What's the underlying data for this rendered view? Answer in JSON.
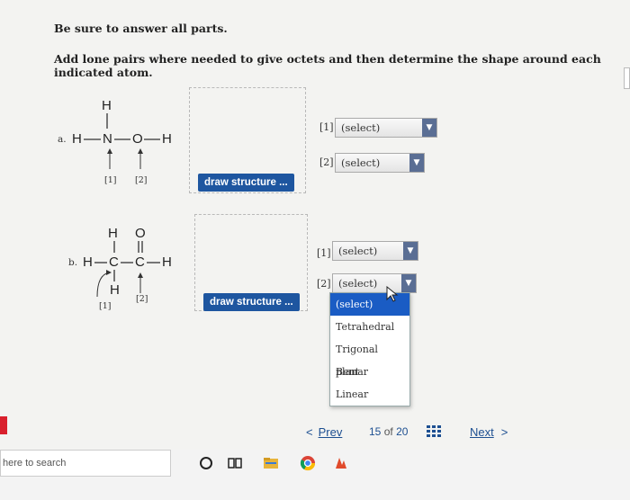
{
  "instructions": {
    "line1": "Be sure to answer all parts.",
    "line2": "Add lone pairs where needed to give octets and then determine the shape around each indicated atom."
  },
  "molecule_a": {
    "label": "a.",
    "atoms": {
      "h_top": "H",
      "h_left": "H",
      "n": "N",
      "o": "O",
      "h_right": "H"
    },
    "markers": [
      "[1]",
      "[2]"
    ]
  },
  "molecule_b": {
    "label": "b.",
    "atoms": {
      "h_top": "H",
      "o_top": "O",
      "h_left": "H",
      "c1": "C",
      "c2": "C",
      "h_right": "H",
      "h_bottom": "H"
    },
    "markers": [
      "[1]",
      "[2]"
    ]
  },
  "draw_button_label": "draw structure ...",
  "question_a": {
    "select1": {
      "number": "[1]",
      "value": "(select)"
    },
    "select2": {
      "number": "[2]",
      "value": "(select)"
    }
  },
  "question_b": {
    "select1": {
      "number": "[1]",
      "value": "(select)"
    },
    "select2": {
      "number": "[2]",
      "value": "(select)"
    }
  },
  "dropdown_options": [
    "(select)",
    "Tetrahedral",
    "Trigonal planar",
    "Bent",
    "Linear"
  ],
  "dropdown_selected_index": 0,
  "navigation": {
    "prev": "Prev",
    "page_current": "15",
    "page_of": "of",
    "page_total": "20",
    "next": "Next"
  },
  "taskbar": {
    "search_placeholder": "here to search"
  },
  "colors": {
    "accent": "#1e56a0",
    "dropdown_active": "#1a5cc4",
    "select_arrow": "#5a6e94"
  },
  "icons": [
    "grid-icon",
    "chevron-left-icon",
    "chevron-right-icon",
    "cortana-icon",
    "task-view-icon",
    "file-explorer-icon",
    "chrome-icon",
    "app-icon"
  ]
}
